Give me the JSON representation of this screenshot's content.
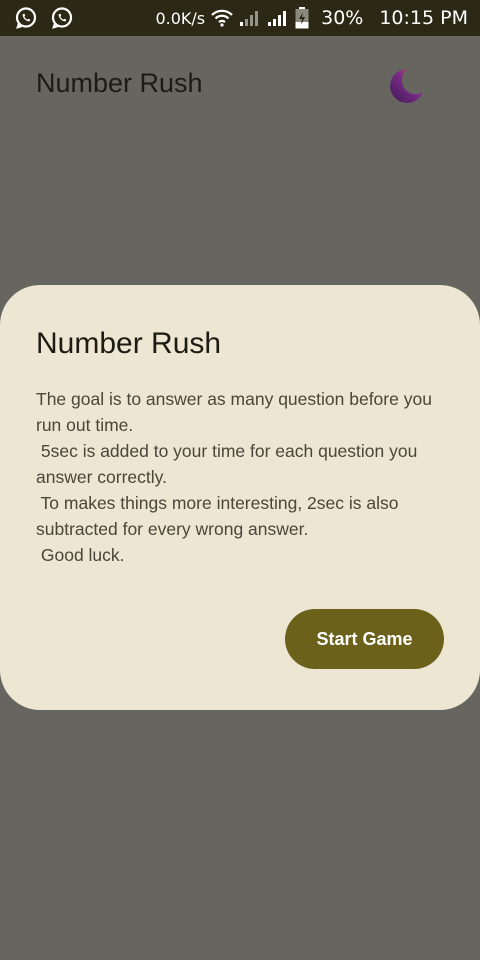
{
  "status_bar": {
    "network_speed": "0.0K/s",
    "battery_percent": "30%",
    "time": "10:15 PM",
    "notification_icons": [
      "whatsapp-icon",
      "whatsapp-icon"
    ],
    "system_icons": [
      "wifi-icon",
      "signal-icon",
      "signal-icon",
      "battery-charging-icon"
    ]
  },
  "app_bar": {
    "title": "Number Rush",
    "action_icon": "moon-icon"
  },
  "dialog": {
    "title": "Number Rush",
    "body_lines": [
      "The goal is to answer as many question before you",
      "run out time.",
      " 5sec is added to your time for each question you",
      "answer correctly.",
      " To makes things more interesting, 2sec is also",
      "subtracted for every wrong answer.",
      " Good luck."
    ],
    "start_button_label": "Start Game"
  },
  "colors": {
    "status_bar_bg": "#2b2915",
    "scrim": "#666560",
    "dialog_bg": "#ede6d2",
    "button_bg": "#6b611a"
  }
}
